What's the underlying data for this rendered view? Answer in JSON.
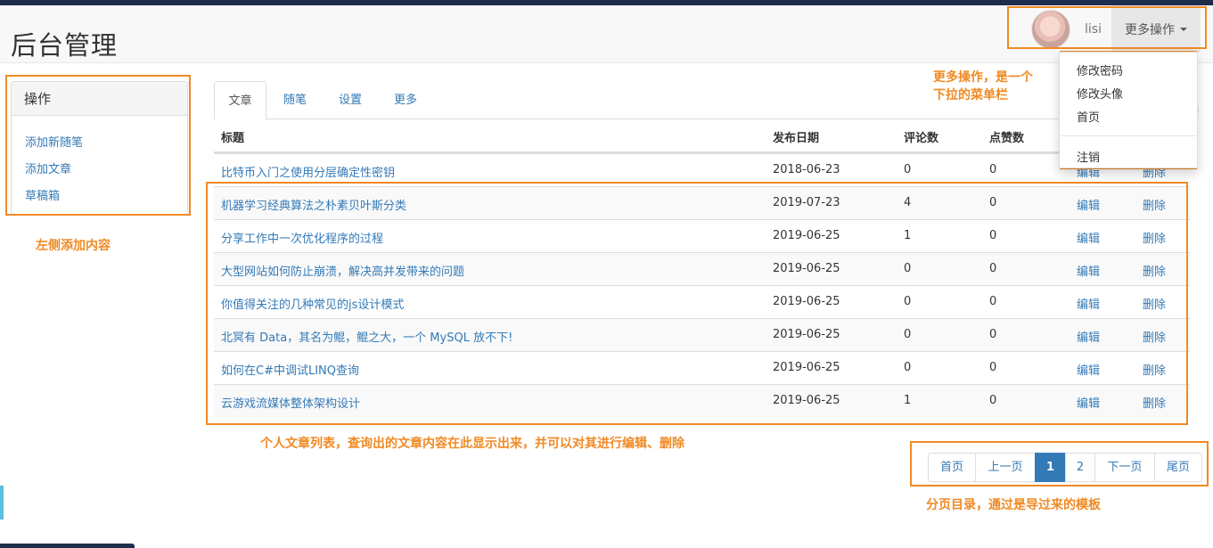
{
  "header": {
    "brand": "后台管理",
    "username": "lisi",
    "more_ops_label": "更多操作"
  },
  "dropdown": {
    "items": [
      "修改密码",
      "修改头像",
      "首页",
      "注销"
    ]
  },
  "sidebar": {
    "title": "操作",
    "links": [
      "添加新随笔",
      "添加文章",
      "草稿箱"
    ]
  },
  "tabs": [
    "文章",
    "随笔",
    "设置",
    "更多"
  ],
  "table": {
    "headers": {
      "title": "标题",
      "date": "发布日期",
      "comments": "评论数",
      "likes": "点赞数"
    },
    "rows": [
      {
        "title": "比特币入门之使用分层确定性密钥",
        "date": "2018-06-23",
        "comments": "0",
        "likes": "0",
        "edit": "编辑",
        "delete": "删除"
      },
      {
        "title": "机器学习经典算法之朴素贝叶斯分类",
        "date": "2019-07-23",
        "comments": "4",
        "likes": "0",
        "edit": "编辑",
        "delete": "删除"
      },
      {
        "title": "分享工作中一次优化程序的过程",
        "date": "2019-06-25",
        "comments": "1",
        "likes": "0",
        "edit": "编辑",
        "delete": "删除"
      },
      {
        "title": "大型网站如何防止崩溃，解决高并发带来的问题",
        "date": "2019-06-25",
        "comments": "0",
        "likes": "0",
        "edit": "编辑",
        "delete": "删除"
      },
      {
        "title": "你值得关注的几种常见的js设计模式",
        "date": "2019-06-25",
        "comments": "0",
        "likes": "0",
        "edit": "编辑",
        "delete": "删除"
      },
      {
        "title": "北冥有 Data，其名为鲲，鲲之大，一个 MySQL 放不下!",
        "date": "2019-06-25",
        "comments": "0",
        "likes": "0",
        "edit": "编辑",
        "delete": "删除"
      },
      {
        "title": "如何在C#中调试LINQ查询",
        "date": "2019-06-25",
        "comments": "0",
        "likes": "0",
        "edit": "编辑",
        "delete": "删除"
      },
      {
        "title": "云游戏流媒体整体架构设计",
        "date": "2019-06-25",
        "comments": "1",
        "likes": "0",
        "edit": "编辑",
        "delete": "删除"
      }
    ]
  },
  "pagination": {
    "first": "首页",
    "prev": "上一页",
    "pages": [
      "1",
      "2"
    ],
    "active_page": "1",
    "next": "下一页",
    "last": "尾页"
  },
  "annotations": {
    "dropdown_note_1": "更多操作，是一个",
    "dropdown_note_2": "下拉的菜单栏",
    "sidebar_note": "左侧添加内容",
    "table_note": "个人文章列表，查询出的文章内容在此显示出来，并可以对其进行编辑、删除",
    "pagination_note": "分页目录，通过是导过来的模板"
  },
  "colors": {
    "accent": "#337ab7",
    "annotation": "#f08a24",
    "topbar": "#1f2d4d"
  }
}
